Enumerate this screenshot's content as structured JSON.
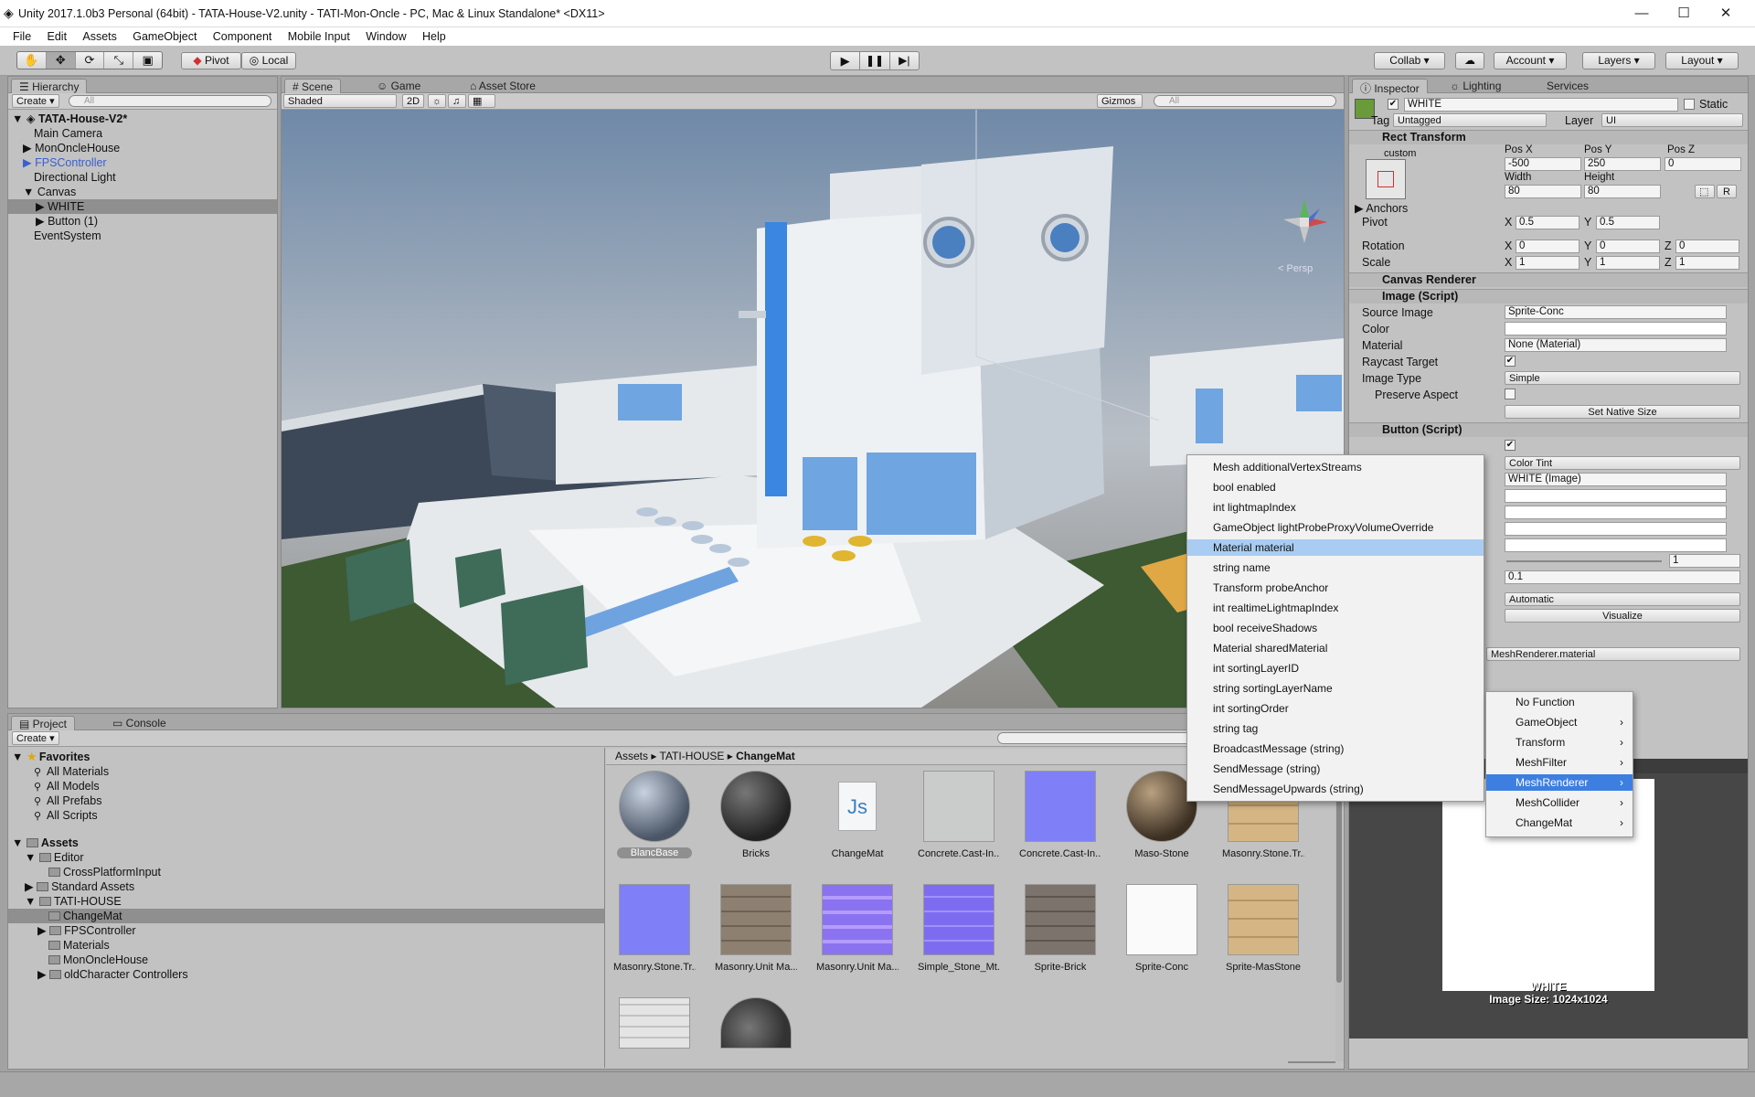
{
  "window": {
    "title": "Unity 2017.1.0b3 Personal (64bit) - TATA-House-V2.unity - TATI-Mon-Oncle - PC, Mac & Linux Standalone* <DX11>",
    "minimize": "—",
    "maximize": "☐",
    "close": "✕"
  },
  "menu": [
    "File",
    "Edit",
    "Assets",
    "GameObject",
    "Component",
    "Mobile Input",
    "Window",
    "Help"
  ],
  "toolbar": {
    "pivot": "Pivot",
    "local": "Local",
    "collab": "Collab ▾",
    "account": "Account ▾",
    "layers": "Layers ▾",
    "layout": "Layout ▾"
  },
  "hierarchy": {
    "tab": "Hierarchy",
    "create": "Create ▾",
    "search": "All",
    "scene": "TATA-House-V2*",
    "items": [
      "Main Camera",
      "MonOncleHouse",
      "FPSController",
      "Directional Light",
      "Canvas",
      "WHITE",
      "Button (1)",
      "EventSystem"
    ]
  },
  "scene": {
    "tabs": [
      "Scene",
      "Game",
      "Asset Store"
    ],
    "shading": "Shaded",
    "mode2d": "2D",
    "gizmos": "Gizmos ▾",
    "search": "All",
    "persp": "< Persp"
  },
  "project": {
    "tabs": [
      "Project",
      "Console"
    ],
    "create": "Create ▾",
    "favorites": "Favorites",
    "fav_items": [
      "All Materials",
      "All Models",
      "All Prefabs",
      "All Scripts"
    ],
    "assets": "Assets",
    "tree": [
      "Editor",
      "CrossPlatformInput",
      "Standard Assets",
      "TATI-HOUSE",
      "ChangeMat",
      "FPSController",
      "Materials",
      "MonOncleHouse",
      "oldCharacter Controllers"
    ],
    "breadcrumb": [
      "Assets",
      "TATI-HOUSE",
      "ChangeMat"
    ],
    "files": [
      "BlancBase",
      "Bricks",
      "ChangeMat",
      "Concrete.Cast-In...",
      "Concrete.Cast-In...",
      "Maso-Stone",
      "Masonry.Stone.Tr...",
      "Masonry.Stone.Tr...",
      "Masonry.Unit Ma...",
      "Masonry.Unit Ma...",
      "Simple_Stone_Mt...",
      "Sprite-Brick",
      "Sprite-Conc",
      "Sprite-MasStone"
    ]
  },
  "inspector": {
    "tabs": [
      "Inspector",
      "Lighting",
      "Services"
    ],
    "name": "WHITE",
    "static": "Static",
    "tag_label": "Tag",
    "tag": "Untagged",
    "layer_label": "Layer",
    "layer": "UI",
    "rect": {
      "title": "Rect Transform",
      "custom": "custom",
      "posx_l": "Pos X",
      "posy_l": "Pos Y",
      "posz_l": "Pos Z",
      "posx": "-500",
      "posy": "250",
      "posz": "0",
      "w_l": "Width",
      "h_l": "Height",
      "w": "80",
      "h": "80",
      "anchors": "Anchors",
      "pivot": "Pivot",
      "rotation": "Rotation",
      "scale": "Scale",
      "px": "0.5",
      "py": "0.5",
      "rx": "0",
      "ry": "0",
      "rz": "0",
      "sx": "1",
      "sy": "1",
      "sz": "1",
      "x": "X",
      "y": "Y",
      "z": "Z",
      "r": "R"
    },
    "canvas_renderer": "Canvas Renderer",
    "image": {
      "title": "Image (Script)",
      "source_l": "Source Image",
      "source": "Sprite-Conc",
      "color_l": "Color",
      "material_l": "Material",
      "material": "None (Material)",
      "raycast_l": "Raycast Target",
      "type_l": "Image Type",
      "type": "Simple",
      "preserve_l": "Preserve Aspect",
      "native": "Set Native Size"
    },
    "button": {
      "title": "Button (Script)",
      "transition": "Color Tint",
      "target": "WHITE (Image)",
      "mult": "1",
      "fade": "0.1",
      "nav": "Automatic",
      "visualize": "Visualize",
      "fn": "MeshRenderer.material"
    },
    "preview_title": "WHITE ‡",
    "preview_name": "WHITE",
    "preview_size": "Image Size: 1024x1024"
  },
  "menu1": [
    "Mesh additionalVertexStreams",
    "bool enabled",
    "int lightmapIndex",
    "GameObject lightProbeProxyVolumeOverride",
    "Material material",
    "string name",
    "Transform probeAnchor",
    "int realtimeLightmapIndex",
    "bool receiveShadows",
    "Material sharedMaterial",
    "int sortingLayerID",
    "string sortingLayerName",
    "int sortingOrder",
    "string tag",
    "BroadcastMessage (string)",
    "SendMessage (string)",
    "SendMessageUpwards (string)"
  ],
  "menu2": [
    "No Function",
    "GameObject",
    "Transform",
    "MeshFilter",
    "MeshRenderer",
    "MeshCollider",
    "ChangeMat"
  ],
  "colors": {
    "accent": "#a9cdf2",
    "selected": "#8f8f8f",
    "link": "#3a5fcd"
  }
}
